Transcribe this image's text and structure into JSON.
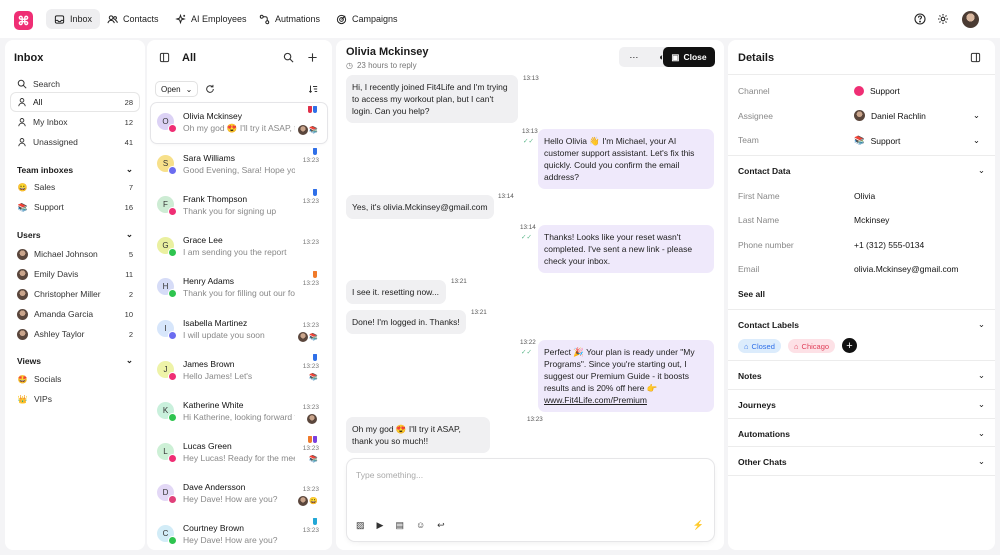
{
  "nav": {
    "items": [
      {
        "label": "Inbox"
      },
      {
        "label": "Contacts"
      },
      {
        "label": "AI Employees"
      },
      {
        "label": "Autmations"
      },
      {
        "label": "Campaigns"
      }
    ]
  },
  "inbox": {
    "title": "Inbox",
    "search": "Search",
    "rows": [
      {
        "label": "All",
        "count": "28"
      },
      {
        "label": "My Inbox",
        "count": "12"
      },
      {
        "label": "Unassigned",
        "count": "41"
      }
    ],
    "team_title": "Team inboxes",
    "teams": [
      {
        "emoji": "😀",
        "label": "Sales",
        "count": "7"
      },
      {
        "emoji": "📚",
        "label": "Support",
        "count": "16"
      }
    ],
    "users_title": "Users",
    "users": [
      {
        "label": "Michael Johnson",
        "count": "5"
      },
      {
        "label": "Emily Davis",
        "count": "11"
      },
      {
        "label": "Christopher Miller",
        "count": "2"
      },
      {
        "label": "Amanda Garcia",
        "count": "10"
      },
      {
        "label": "Ashley Taylor",
        "count": "2"
      }
    ],
    "views_title": "Views",
    "views": [
      {
        "emoji": "🤩",
        "label": "Socials"
      },
      {
        "emoji": "👑",
        "label": "VIPs"
      }
    ]
  },
  "list": {
    "title": "All",
    "filter": "Open",
    "conversations": [
      {
        "initial": "O",
        "name": "Olivia Mckinsey",
        "preview": "Oh my god 😍 I'll try it ASAP, thank you so much!!",
        "time": "",
        "mini": "📚",
        "av": "#dcd2f5",
        "badge": "#ef2e74",
        "tags": [
          "#e0304a",
          "#2f6fe8"
        ]
      },
      {
        "initial": "S",
        "name": "Sara Williams",
        "preview": "Good Evening, Sara! Hope you're doing well",
        "time": "13:23",
        "mini": "",
        "av": "#f7e08a",
        "badge": "#6b6cf0",
        "tags": [
          "#2f6fe8"
        ]
      },
      {
        "initial": "F",
        "name": "Frank Thompson",
        "preview": "Thank you for signing up",
        "time": "13:23",
        "mini": "",
        "av": "#cdecd4",
        "badge": "#ef2e74",
        "tags": [
          "#2f6fe8"
        ]
      },
      {
        "initial": "G",
        "name": "Grace Lee",
        "preview": "I am sending you the report",
        "time": "13:23",
        "mini": "",
        "av": "#eaf0a0",
        "badge": "#2ec44f",
        "tags": []
      },
      {
        "initial": "H",
        "name": "Henry Adams",
        "preview": "Thank you for filling out our form",
        "time": "13:23",
        "mini": "",
        "av": "#d6dcf7",
        "badge": "#2ec44f",
        "tags": [
          "#f07a2a"
        ]
      },
      {
        "initial": "I",
        "name": "Isabella Martinez",
        "preview": "I will update you soon",
        "time": "13:23",
        "mini": "📚",
        "av": "#d7e6fb",
        "badge": "#6b6cf0",
        "tags": []
      },
      {
        "initial": "J",
        "name": "James Brown",
        "preview": "Hello James! Let's",
        "time": "13:23",
        "mini": "📚",
        "av": "#eef3a8",
        "badge": "#ef2e74",
        "tags": [
          "#2f6fe8"
        ]
      },
      {
        "initial": "K",
        "name": "Katherine White",
        "preview": "Hi Katherine, looking forward to it",
        "time": "13:23",
        "mini": "",
        "av": "#c9f0dc",
        "badge": "#2ec44f",
        "tags": []
      },
      {
        "initial": "L",
        "name": "Lucas Green",
        "preview": "Hey Lucas! Ready for the meeting?",
        "time": "13:23",
        "mini": "📚",
        "av": "#cdf0d6",
        "badge": "#ef2e74",
        "tags": [
          "#f07a2a",
          "#7a3fe0"
        ]
      },
      {
        "initial": "D",
        "name": "Dave Andersson",
        "preview": "Hey Dave! How are you?",
        "time": "13:23",
        "mini": "😀",
        "av": "#e3d8f6",
        "badge": "#e0407a",
        "tags": []
      },
      {
        "initial": "C",
        "name": "Courtney Brown",
        "preview": "Hey Dave! How are you?",
        "time": "13:23",
        "mini": "",
        "av": "#d2ecf7",
        "badge": "#2ec44f",
        "tags": [
          "#22a7d6"
        ]
      }
    ]
  },
  "chat": {
    "name": "Olivia Mckinsey",
    "subtitle": "23 hours to reply",
    "close_label": "Close",
    "composer_placeholder": "Type something...",
    "messages": [
      {
        "dir": "in",
        "text": "Hi, I recently joined Fit4Life and I'm trying to access my workout plan, but I can't login. Can you help?",
        "time": "13:13"
      },
      {
        "dir": "out",
        "text": "Hello Olivia 👋 I'm Michael, your AI customer support assistant. Let's fix this quickly. Could you confirm the email address?",
        "time": "13:13"
      },
      {
        "dir": "in",
        "text": "Yes, it's olivia.Mckinsey@gmail.com",
        "time": "13:14"
      },
      {
        "dir": "out",
        "text": "Thanks! Looks like your reset wasn't completed. I've sent a new link - please check your inbox.",
        "time": "13:14"
      },
      {
        "dir": "in",
        "text": "I see it. resetting now...",
        "time": "13:21"
      },
      {
        "dir": "in",
        "text": "Done! I'm logged in. Thanks!",
        "time": "13:21"
      },
      {
        "dir": "out",
        "text": "Perfect 🎉 Your plan is ready under \"My Programs\". Since you're starting out, I suggest our Premium Guide - it boosts results and is 20% off here 👉 ",
        "link": "www.Fit4Life.com/Premium",
        "time": "13:22"
      },
      {
        "dir": "in",
        "text": "Oh my god 😍 I'll try it ASAP, thank you so much!!",
        "time": "13:23"
      }
    ]
  },
  "details": {
    "title": "Details",
    "channel_label": "Channel",
    "channel_value": "Support",
    "assignee_label": "Assignee",
    "assignee_value": "Daniel Rachlin",
    "team_label": "Team",
    "team_value": "Support",
    "contact_title": "Contact Data",
    "fields": [
      {
        "label": "First Name",
        "value": "Olivia"
      },
      {
        "label": "Last Name",
        "value": "Mckinsey"
      },
      {
        "label": "Phone number",
        "value": "+1 (312) 555-0134"
      },
      {
        "label": "Email",
        "value": "olivia.Mckinsey@gmail.com"
      }
    ],
    "see_all": "See all",
    "labels_title": "Contact Labels",
    "labels": [
      {
        "text": "Closed",
        "bg": "#dcecfc",
        "color": "#2f6fe8"
      },
      {
        "text": "Chicago",
        "bg": "#fde1e6",
        "color": "#e0405a"
      }
    ],
    "sections": [
      {
        "label": "Notes"
      },
      {
        "label": "Journeys"
      },
      {
        "label": "Automations"
      },
      {
        "label": "Other Chats"
      }
    ]
  }
}
